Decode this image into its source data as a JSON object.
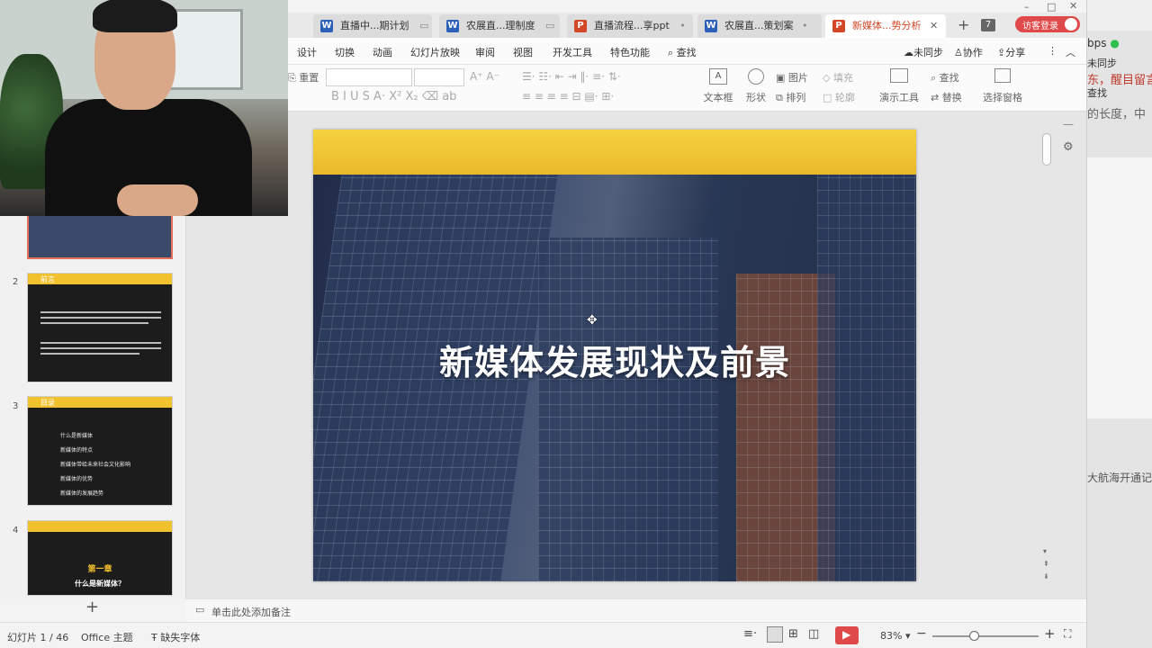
{
  "tabs": [
    {
      "label": "直播中...期计划",
      "type": "W",
      "color": "#2b5fb8"
    },
    {
      "label": "农展直...理制度",
      "type": "W",
      "color": "#2b5fb8"
    },
    {
      "label": "直播流程...享ppt",
      "type": "P",
      "color": "#d24726"
    },
    {
      "label": "农展直...策划案",
      "type": "W",
      "color": "#2b5fb8"
    },
    {
      "label": "新媒体...势分析",
      "type": "P",
      "color": "#d24726"
    }
  ],
  "tab_count": "7",
  "login_button": "访客登录",
  "menu": [
    "设计",
    "切换",
    "动画",
    "幻灯片放映",
    "审阅",
    "视图",
    "开发工具",
    "特色功能"
  ],
  "search_label": "查找",
  "top_actions": {
    "sync": "未同步",
    "collab": "协作",
    "share": "分享"
  },
  "toolbar": {
    "reset": "重置",
    "textbox": "文本框",
    "shape": "形状",
    "picture": "图片",
    "fill": "填充",
    "arrange": "排列",
    "outline": "轮廓",
    "present_tools": "演示工具",
    "find": "查找",
    "replace": "替换",
    "select_pane": "选择窗格"
  },
  "thumbs": [
    {
      "num": "2",
      "title": "前言"
    },
    {
      "num": "3",
      "title": "目录",
      "items": [
        "什么是新媒体",
        "新媒体的特点",
        "新媒体带给未来社会文化影响",
        "新媒体的优势",
        "新媒体的发展趋势"
      ]
    },
    {
      "num": "4",
      "chapter": "第一章",
      "subtitle": "什么是新媒体？"
    }
  ],
  "slide": {
    "title": "新媒体发展现状及前景"
  },
  "notes_placeholder": "单击此处添加备注",
  "status": {
    "slide_of": "幻灯片 1 / 46",
    "theme": "Office 主题",
    "missing_font": "缺失字体",
    "zoom": "83%"
  },
  "right_strip": {
    "speed": "bps",
    "sync": "未同步",
    "text1": "东，醒目留言",
    "search": "查找",
    "text2": "的长度，中",
    "text3": "大航海开通记"
  }
}
